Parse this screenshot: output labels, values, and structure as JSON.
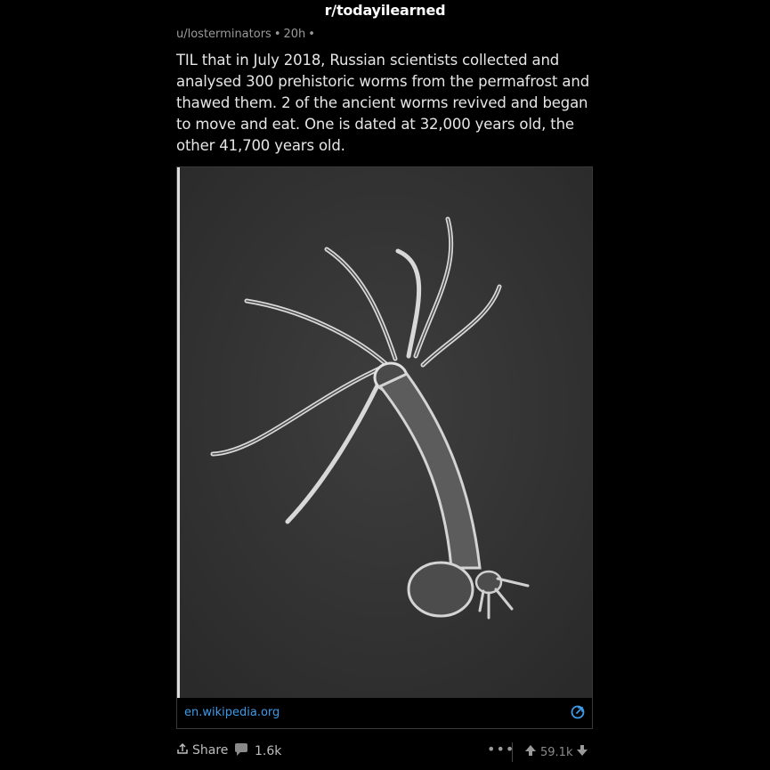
{
  "header": {
    "subreddit": "r/todayilearned"
  },
  "post": {
    "author": "u/losterminators",
    "age": "20h",
    "separator": "•",
    "title": "TIL that in July 2018, Russian scientists collected and analysed 300 prehistoric worms from the permafrost and thawed them. 2 of the ancient worms revived and began to move and eat. One is dated at 32,000 years old, the other 41,700 years old."
  },
  "media": {
    "domain": "en.wikipedia.org",
    "link_icon": "external-link-icon",
    "image_subject": "hydra-organism-photo"
  },
  "actions": {
    "share_label": "Share",
    "comment_count": "1.6k",
    "more_label": "•••",
    "vote_count": "59.1k"
  },
  "colors": {
    "background": "#000000",
    "link": "#3d9be9",
    "meta_text": "#9a9a9a"
  }
}
